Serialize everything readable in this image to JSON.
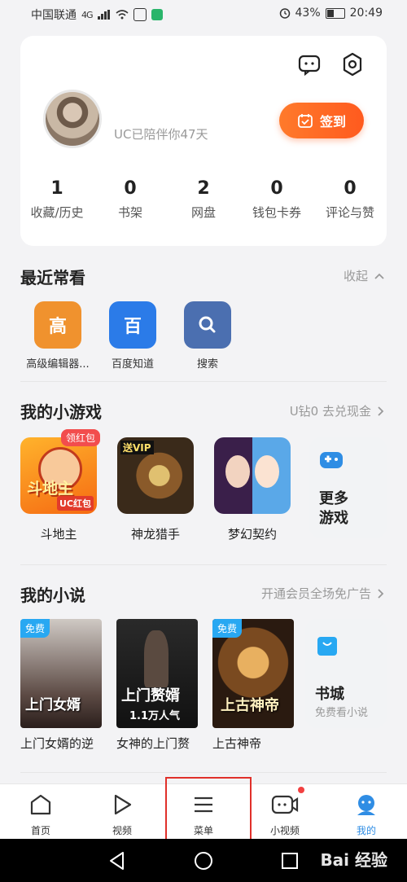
{
  "status_bar": {
    "carrier": "中国联通",
    "network": "4G",
    "battery": "43%",
    "time": "20:49"
  },
  "profile": {
    "companion_text": "UC已陪伴你47天",
    "checkin_label": "签到",
    "stats": [
      {
        "value": "1",
        "label": "收藏/历史"
      },
      {
        "value": "0",
        "label": "书架"
      },
      {
        "value": "2",
        "label": "网盘"
      },
      {
        "value": "0",
        "label": "钱包卡券"
      },
      {
        "value": "0",
        "label": "评论与赞"
      }
    ]
  },
  "recent": {
    "title": "最近常看",
    "action": "收起",
    "items": [
      {
        "glyph": "高",
        "label": "高级编辑器...",
        "color": "#f0922e"
      },
      {
        "glyph": "百",
        "label": "百度知道",
        "color": "#2b7be8"
      },
      {
        "glyph": "",
        "label": "搜索",
        "color": "#4b6fb0"
      }
    ]
  },
  "games": {
    "title": "我的小游戏",
    "action": "U钻0 去兑现金",
    "items": [
      {
        "label": "斗地主",
        "badge": "领红包",
        "art_text": "斗地主",
        "sub_text": "UC红包"
      },
      {
        "label": "神龙猎手",
        "art_text": "送VIP"
      },
      {
        "label": "梦幻契约"
      }
    ],
    "more_label": "更多游戏"
  },
  "novels": {
    "title": "我的小说",
    "action": "开通会员全场免广告",
    "items": [
      {
        "label": "上门女婿的逆",
        "tag": "免费",
        "art_text": "上门女婿"
      },
      {
        "label": "女神的上门赘",
        "tag": "",
        "art_text": "上门赘婿",
        "sub_text": "1.1万人气"
      },
      {
        "label": "上古神帝",
        "tag": "免费",
        "art_text": "上古神帝"
      }
    ],
    "shop_label": "书城",
    "shop_sub": "免费看小说"
  },
  "tabbar": [
    {
      "label": "首页",
      "icon": "home-icon"
    },
    {
      "label": "视频",
      "icon": "play-icon"
    },
    {
      "label": "菜单",
      "icon": "menu-icon"
    },
    {
      "label": "小视频",
      "icon": "camera-icon"
    },
    {
      "label": "我的",
      "icon": "profile-icon",
      "active": true
    }
  ],
  "watermark": "Bai 经验",
  "colors": {
    "accent": "#ff6a22",
    "active_tab": "#2f8de4",
    "highlight_box": "#e0302a"
  }
}
